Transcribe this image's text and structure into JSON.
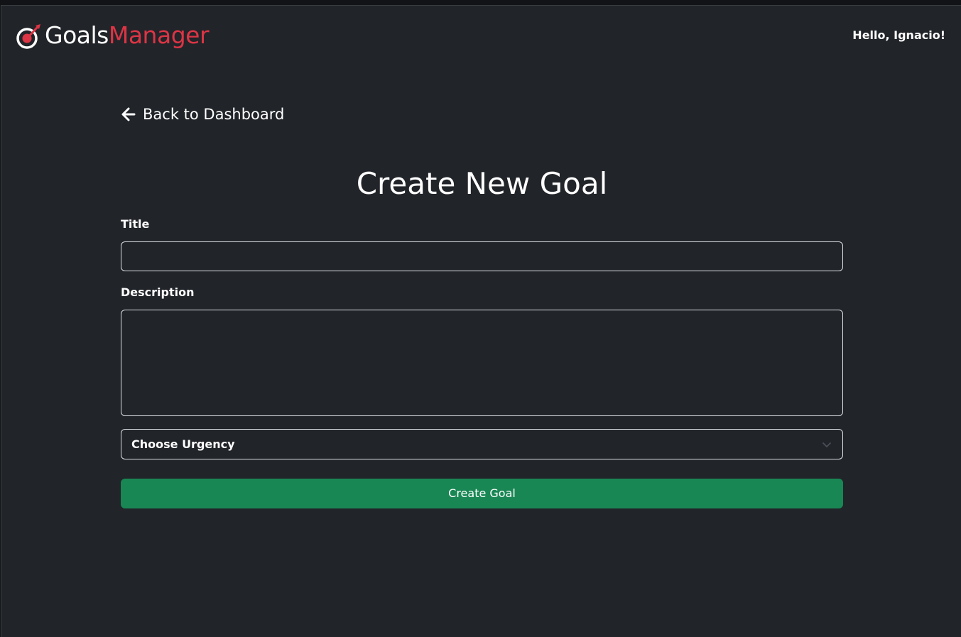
{
  "header": {
    "brand_goals": "Goals",
    "brand_manager": "Manager",
    "greeting": "Hello, Ignacio!"
  },
  "nav": {
    "back_label": "Back to Dashboard"
  },
  "form": {
    "heading": "Create New Goal",
    "title_label": "Title",
    "title_value": "",
    "description_label": "Description",
    "description_value": "",
    "urgency_selected": "Choose Urgency",
    "submit_label": "Create Goal"
  },
  "colors": {
    "background": "#212429",
    "brand_accent": "#dc3545",
    "submit_button": "#198754",
    "text": "#ffffff",
    "field_border": "#dee2e6"
  },
  "icons": {
    "logo": "target-arrow-icon",
    "back": "arrow-left-icon",
    "select": "chevron-down-icon"
  }
}
